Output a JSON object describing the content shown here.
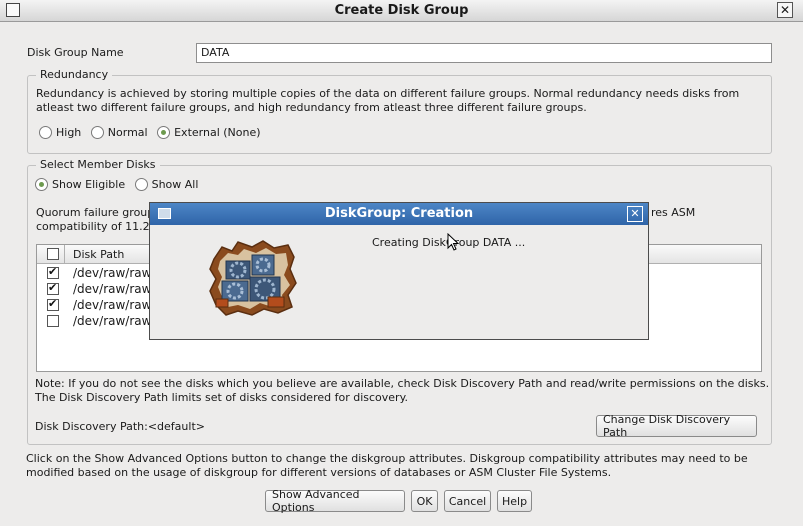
{
  "window": {
    "title": "Create Disk Group",
    "close_glyph": "✕"
  },
  "disk_group_name": {
    "label": "Disk Group Name",
    "value": "DATA"
  },
  "redundancy": {
    "legend": "Redundancy",
    "description": "Redundancy is achieved by storing multiple copies of the data on different failure groups. Normal redundancy needs disks from atleast two different failure groups, and high redundancy from atleast three different failure groups.",
    "options": [
      {
        "label": "High",
        "selected": false
      },
      {
        "label": "Normal",
        "selected": false
      },
      {
        "label": "External (None)",
        "selected": true
      }
    ]
  },
  "member_disks": {
    "legend": "Select Member Disks",
    "filter_options": [
      {
        "label": "Show Eligible",
        "selected": true
      },
      {
        "label": "Show All",
        "selected": false
      }
    ],
    "quorum_text_left": "Quorum failure group",
    "quorum_text_right": "res ASM",
    "compat_text": "compatibility of 11.2",
    "table": {
      "header_path": "Disk Path",
      "rows": [
        {
          "checked": true,
          "path": "/dev/raw/raw"
        },
        {
          "checked": true,
          "path": "/dev/raw/raw"
        },
        {
          "checked": true,
          "path": "/dev/raw/raw"
        },
        {
          "checked": false,
          "path": "/dev/raw/raw"
        }
      ]
    },
    "note": "Note: If you do not see the disks which you believe are available, check Disk Discovery Path and read/write permissions on the disks. The Disk Discovery Path limits set of disks considered for discovery.",
    "discovery_path_label": "Disk Discovery Path:<default>",
    "change_path_button": "Change Disk Discovery Path"
  },
  "advanced_note": "Click on the Show Advanced Options button to change the diskgroup attributes. Diskgroup compatibility attributes may need to be modified based on the usage of diskgroup for different versions of databases or ASM Cluster File Systems.",
  "buttons": {
    "advanced": "Show Advanced Options",
    "ok": "OK",
    "cancel": "Cancel",
    "help": "Help"
  },
  "popup": {
    "title": "DiskGroup: Creation",
    "message": "Creating DiskGroup DATA ...",
    "close_glyph": "✕",
    "icon": "gears-wall-icon"
  },
  "colors": {
    "popup_titlebar": "#3a72b6",
    "radio_selected": "#6d9a4e",
    "window_bg": "#edeceb"
  }
}
